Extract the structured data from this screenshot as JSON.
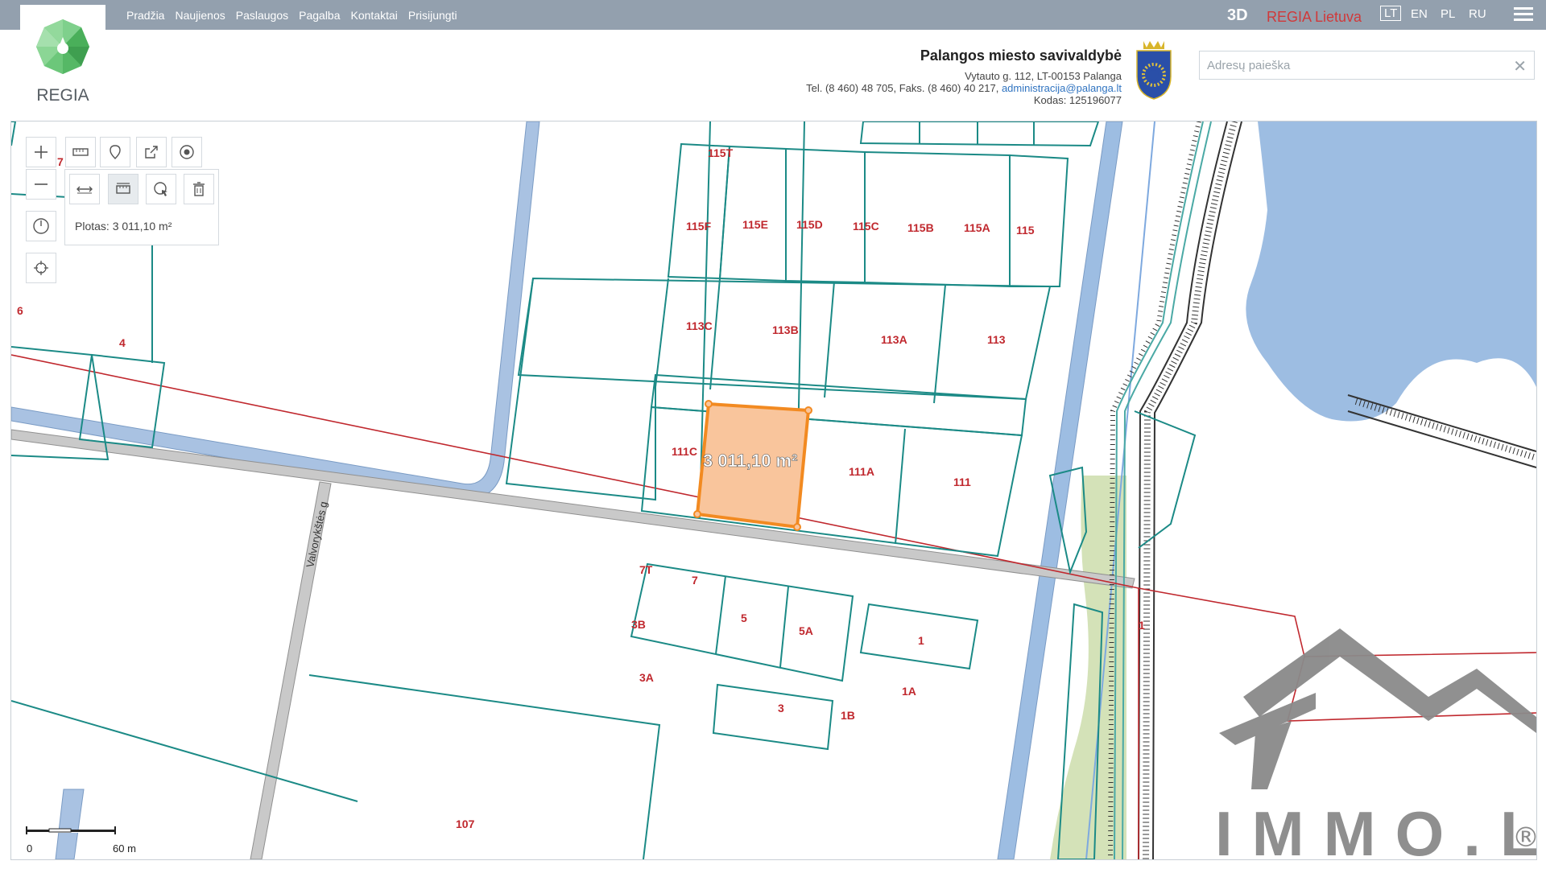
{
  "nav": {
    "items": [
      "Pradžia",
      "Naujienos",
      "Paslaugos",
      "Pagalba",
      "Kontaktai",
      "Prisijungti"
    ]
  },
  "topbar": {
    "btn_3d": "3D",
    "regia_lietuva": "REGIA Lietuva",
    "languages": [
      "LT",
      "EN",
      "PL",
      "RU"
    ],
    "active_language": "LT"
  },
  "logo": {
    "text": "REGIA"
  },
  "municipality": {
    "title": "Palangos miesto savivaldybė",
    "address": "Vytauto g. 112, LT-00153 Palanga",
    "phone_fax": "Tel. (8 460) 48 705, Faks. (8 460) 40 217,",
    "email": "administracija@palanga.lt",
    "code": "Kodas: 125196077"
  },
  "search": {
    "placeholder": "Adresų paieška",
    "value": ""
  },
  "measure": {
    "area_label": "Plotas: 3 011,10 m²",
    "polygon_label": "3 011,10 m²"
  },
  "scale": {
    "start": "0",
    "end": "60 m"
  },
  "street_label": "Valvorykštės g",
  "parcel_labels": [
    "115T",
    "115F",
    "115E",
    "115D",
    "115C",
    "115B",
    "115A",
    "115",
    "113C",
    "113B",
    "113A",
    "113",
    "111C",
    "111A",
    "111",
    "7T",
    "7",
    "3B",
    "5",
    "5A",
    "1",
    "3A",
    "3",
    "1B",
    "1A",
    "107",
    "4",
    "6",
    "7",
    "1"
  ],
  "watermark": {
    "text": "IMMO.LT",
    "reg": "®"
  },
  "colors": {
    "topbar": "#93a0ae",
    "parcel": "#1b8a86",
    "road": "#8faed4",
    "water": "#9dbde2",
    "green": "#d4e2b8",
    "selection_fill": "#f9c59c",
    "selection_stroke": "#f28a21",
    "utility_line": "#c0282e",
    "label": "#c0282e",
    "accent": "#d0393a"
  },
  "icons": {
    "zoom_in": "plus-icon",
    "zoom_out": "minus-icon",
    "measure_distance": "ruler-icon",
    "marker": "map-pin-icon",
    "share": "share-icon",
    "point": "target-icon",
    "line": "arrows-horizontal-icon",
    "area": "area-measure-icon",
    "pointer": "cursor-globe-icon",
    "delete": "trash-icon",
    "history": "clock-icon",
    "locate": "crosshair-icon"
  }
}
